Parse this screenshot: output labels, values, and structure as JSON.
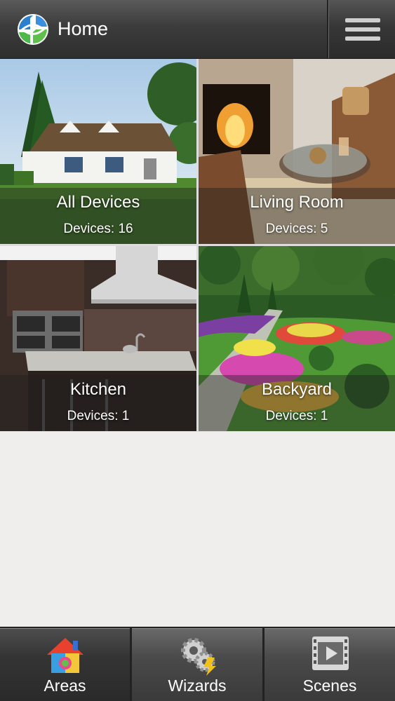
{
  "header": {
    "title": "Home"
  },
  "areas": [
    {
      "name": "All Devices",
      "devices": "Devices: 16"
    },
    {
      "name": "Living Room",
      "devices": "Devices: 5"
    },
    {
      "name": "Kitchen",
      "devices": "Devices: 1"
    },
    {
      "name": "Backyard",
      "devices": "Devices: 1"
    }
  ],
  "tabs": [
    {
      "label": "Areas",
      "icon": "house-icon"
    },
    {
      "label": "Wizards",
      "icon": "gears-icon"
    },
    {
      "label": "Scenes",
      "icon": "film-icon"
    }
  ],
  "colors": {
    "header": "#3c3c3c",
    "background": "#efeeec",
    "tabbar": "#4a4a4a"
  }
}
